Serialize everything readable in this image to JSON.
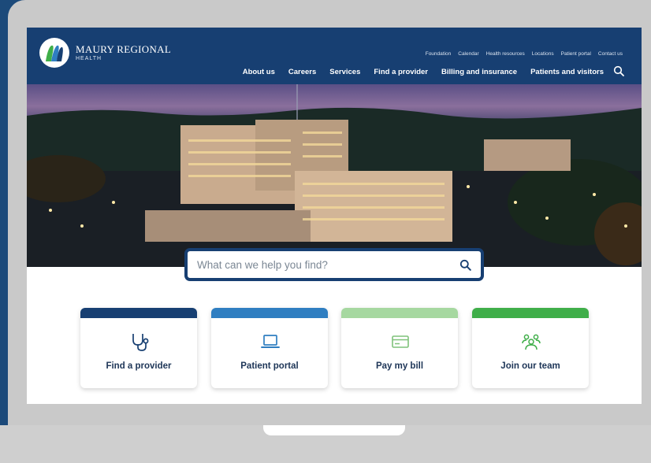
{
  "logo": {
    "line1": "MAURY REGIONAL",
    "line2": "HEALTH"
  },
  "utility_nav": [
    "Foundation",
    "Calendar",
    "Health resources",
    "Locations",
    "Patient portal",
    "Contact us"
  ],
  "main_nav": [
    "About us",
    "Careers",
    "Services",
    "Find a provider",
    "Billing and insurance",
    "Patients and visitors"
  ],
  "search": {
    "placeholder": "What can we help you find?"
  },
  "cards": [
    {
      "label": "Find a provider",
      "icon": "stethoscope-icon",
      "band_color": "#173f72",
      "icon_color": "#173f72"
    },
    {
      "label": "Patient portal",
      "icon": "laptop-icon",
      "band_color": "#2f7ec1",
      "icon_color": "#2f7ec1"
    },
    {
      "label": "Pay my bill",
      "icon": "credit-card-icon",
      "band_color": "#a6d8a0",
      "icon_color": "#7fc27a"
    },
    {
      "label": "Join our team",
      "icon": "people-group-icon",
      "band_color": "#3fae49",
      "icon_color": "#3fae49"
    }
  ],
  "colors": {
    "header": "#173f72",
    "frame": "#c9c9c9",
    "page_background": "#1c4a7a"
  }
}
